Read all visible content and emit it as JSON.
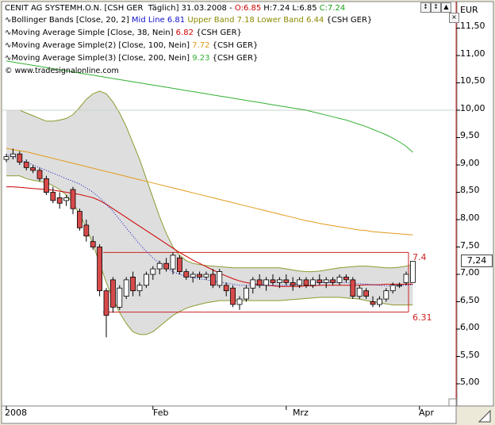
{
  "header": {
    "instrument": "CENIT AG SYSTEMH.O.N. [CSH GER  Täglich] 31.03.2008 - ",
    "open": "O:6.85",
    "high": "H:7.24",
    "low": "L:6.85",
    "close": "C:7.24"
  },
  "indicators": [
    {
      "prefix": "∿Bollinger Bands [Close, 20, 2] ",
      "mid": "Mid Line 6.81",
      "upper": " Upper Band 7.18",
      "lower": " Lower Band 6.44",
      "suffix": " {CSH GER}"
    },
    {
      "prefix": "∿Moving Average Simple [Close, 38, Nein] ",
      "value": "6.82",
      "suffix": " {CSH GER}"
    },
    {
      "prefix": "∿Moving Average Simple(2) [Close, 100, Nein] ",
      "value": "7.72",
      "suffix": " {CSH GER}"
    },
    {
      "prefix": "∿Moving Average Simple(3) [Close, 200, Nein] ",
      "value": "9.23",
      "suffix": " {CSH GER}"
    }
  ],
  "watermark": "© www.tradesignalonline.com",
  "window_buttons": [
    "↕",
    "↕",
    "▲",
    "×"
  ],
  "price_tag": "7,24",
  "colors": {
    "mid": "#1111cc",
    "upper": "#8a8a00",
    "ma38": "#cc0000",
    "ma100": "#e39a1a",
    "ma200": "#33b033",
    "band_fill": "#d8d8d8",
    "band_edge": "#8c9a2e",
    "up_candle": "#ffffff",
    "down_candle": "#d84a4a"
  },
  "chart_data": {
    "type": "candlestick",
    "y_unit": "EUR",
    "ylim": [
      4.5,
      12.0
    ],
    "y_ticks": [
      "11,50",
      "11,00",
      "10,50",
      "10,00",
      "9,50",
      "9,00",
      "8,50",
      "8,00",
      "7,50",
      "7,00",
      "6,50",
      "6,00",
      "5,50",
      "5,00"
    ],
    "y_tick_values": [
      11.5,
      11.0,
      10.5,
      10.0,
      9.5,
      9.0,
      8.5,
      8.0,
      7.5,
      7.0,
      6.5,
      6.0,
      5.5,
      5.0
    ],
    "x_ticks": [
      "2008",
      "Feb",
      "Mrz",
      "Apr"
    ],
    "x_tick_index": [
      0,
      22,
      42,
      62
    ],
    "n_slots": 62,
    "candles": [
      [
        9.1,
        9.2,
        9.05,
        9.15
      ],
      [
        9.15,
        9.3,
        9.1,
        9.2
      ],
      [
        9.2,
        9.25,
        9.0,
        9.05
      ],
      [
        9.05,
        9.1,
        8.9,
        8.95
      ],
      [
        8.95,
        9.0,
        8.85,
        8.9
      ],
      [
        8.9,
        8.95,
        8.7,
        8.75
      ],
      [
        8.75,
        8.8,
        8.45,
        8.5
      ],
      [
        8.5,
        8.6,
        8.3,
        8.35
      ],
      [
        8.4,
        8.5,
        8.2,
        8.3
      ],
      [
        8.35,
        8.45,
        8.25,
        8.4
      ],
      [
        8.55,
        8.6,
        8.1,
        8.2
      ],
      [
        8.15,
        8.2,
        7.8,
        7.85
      ],
      [
        7.9,
        8.0,
        7.6,
        7.7
      ],
      [
        7.6,
        7.7,
        7.45,
        7.5
      ],
      [
        7.5,
        7.55,
        6.6,
        6.7
      ],
      [
        6.7,
        6.75,
        5.85,
        6.25
      ],
      [
        6.9,
        6.95,
        6.3,
        6.4
      ],
      [
        6.4,
        6.8,
        6.35,
        6.75
      ],
      [
        6.6,
        6.95,
        6.55,
        6.9
      ],
      [
        6.95,
        7.05,
        6.6,
        6.7
      ],
      [
        6.7,
        6.85,
        6.6,
        6.8
      ],
      [
        6.8,
        7.05,
        6.75,
        7.0
      ],
      [
        7.0,
        7.15,
        6.9,
        7.1
      ],
      [
        7.1,
        7.25,
        7.0,
        7.2
      ],
      [
        7.2,
        7.3,
        7.05,
        7.1
      ],
      [
        7.1,
        7.4,
        7.0,
        7.35
      ],
      [
        7.3,
        7.35,
        7.0,
        7.05
      ],
      [
        7.05,
        7.1,
        6.9,
        6.95
      ],
      [
        6.95,
        7.05,
        6.85,
        7.0
      ],
      [
        7.0,
        7.05,
        6.9,
        6.95
      ],
      [
        6.95,
        7.05,
        6.9,
        7.0
      ],
      [
        7.0,
        7.1,
        6.75,
        6.8
      ],
      [
        6.8,
        7.1,
        6.75,
        7.05
      ],
      [
        6.8,
        6.85,
        6.6,
        6.7
      ],
      [
        6.75,
        6.8,
        6.4,
        6.45
      ],
      [
        6.45,
        6.6,
        6.35,
        6.55
      ],
      [
        6.55,
        6.8,
        6.5,
        6.75
      ],
      [
        6.75,
        6.95,
        6.65,
        6.9
      ],
      [
        6.9,
        7.0,
        6.75,
        6.8
      ],
      [
        6.8,
        6.95,
        6.7,
        6.9
      ],
      [
        6.9,
        7.0,
        6.8,
        6.85
      ],
      [
        6.85,
        6.95,
        6.75,
        6.9
      ],
      [
        6.9,
        7.0,
        6.8,
        6.85
      ],
      [
        6.85,
        6.95,
        6.7,
        6.8
      ],
      [
        6.8,
        6.95,
        6.75,
        6.9
      ],
      [
        6.9,
        6.95,
        6.75,
        6.8
      ],
      [
        6.8,
        6.95,
        6.75,
        6.9
      ],
      [
        6.9,
        7.0,
        6.8,
        6.85
      ],
      [
        6.85,
        6.95,
        6.75,
        6.9
      ],
      [
        6.9,
        6.95,
        6.8,
        6.85
      ],
      [
        6.85,
        7.0,
        6.8,
        6.95
      ],
      [
        6.95,
        7.0,
        6.85,
        6.9
      ],
      [
        6.9,
        6.95,
        6.55,
        6.6
      ],
      [
        6.6,
        6.8,
        6.55,
        6.75
      ],
      [
        6.7,
        6.75,
        6.55,
        6.6
      ],
      [
        6.5,
        6.6,
        6.4,
        6.45
      ],
      [
        6.45,
        6.6,
        6.4,
        6.55
      ],
      [
        6.55,
        6.75,
        6.5,
        6.7
      ],
      [
        6.7,
        6.85,
        6.65,
        6.8
      ],
      [
        6.8,
        6.85,
        6.75,
        6.8
      ],
      [
        6.85,
        7.05,
        6.8,
        7.0
      ],
      [
        6.85,
        7.24,
        6.85,
        7.24
      ]
    ],
    "ma38": [
      8.6,
      8.6,
      8.59,
      8.58,
      8.57,
      8.56,
      8.55,
      8.54,
      8.52,
      8.5,
      8.48,
      8.46,
      8.43,
      8.4,
      8.35,
      8.28,
      8.2,
      8.12,
      8.04,
      7.96,
      7.88,
      7.8,
      7.72,
      7.64,
      7.56,
      7.48,
      7.4,
      7.33,
      7.26,
      7.2,
      7.14,
      7.08,
      7.02,
      6.97,
      6.92,
      6.88,
      6.85,
      6.83,
      6.81,
      6.8,
      6.79,
      6.78,
      6.78,
      6.78,
      6.78,
      6.79,
      6.79,
      6.8,
      6.8,
      6.8,
      6.8,
      6.8,
      6.8,
      6.8,
      6.81,
      6.81,
      6.81,
      6.82,
      6.82,
      6.82,
      6.82,
      6.82
    ],
    "ma100": [
      9.3,
      9.28,
      9.26,
      9.24,
      9.21,
      9.18,
      9.15,
      9.12,
      9.09,
      9.06,
      9.03,
      9.0,
      8.97,
      8.94,
      8.91,
      8.88,
      8.85,
      8.82,
      8.79,
      8.76,
      8.73,
      8.7,
      8.67,
      8.64,
      8.61,
      8.58,
      8.55,
      8.52,
      8.49,
      8.46,
      8.43,
      8.4,
      8.37,
      8.34,
      8.31,
      8.28,
      8.25,
      8.22,
      8.19,
      8.16,
      8.13,
      8.1,
      8.07,
      8.04,
      8.01,
      7.98,
      7.96,
      7.93,
      7.91,
      7.89,
      7.87,
      7.85,
      7.83,
      7.81,
      7.8,
      7.78,
      7.77,
      7.76,
      7.75,
      7.74,
      7.73,
      7.72
    ],
    "ma200": [
      10.9,
      10.88,
      10.86,
      10.84,
      10.82,
      10.8,
      10.78,
      10.76,
      10.74,
      10.72,
      10.7,
      10.68,
      10.66,
      10.64,
      10.62,
      10.6,
      10.58,
      10.56,
      10.54,
      10.52,
      10.5,
      10.48,
      10.46,
      10.44,
      10.42,
      10.4,
      10.38,
      10.36,
      10.34,
      10.32,
      10.3,
      10.28,
      10.26,
      10.24,
      10.22,
      10.2,
      10.18,
      10.16,
      10.14,
      10.12,
      10.1,
      10.08,
      10.06,
      10.04,
      10.02,
      10.0,
      9.97,
      9.94,
      9.91,
      9.88,
      9.85,
      9.82,
      9.78,
      9.74,
      9.7,
      9.65,
      9.6,
      9.55,
      9.49,
      9.42,
      9.34,
      9.23
    ],
    "bb_mid": [
      9.2,
      9.15,
      9.1,
      9.05,
      9.0,
      8.95,
      8.9,
      8.85,
      8.8,
      8.75,
      8.7,
      8.65,
      8.58,
      8.5,
      8.4,
      8.28,
      8.15,
      8.0,
      7.85,
      7.7,
      7.55,
      7.42,
      7.3,
      7.2,
      7.12,
      7.05,
      7.0,
      6.97,
      6.94,
      6.92,
      6.9,
      6.88,
      6.86,
      6.84,
      6.82,
      6.8,
      6.8,
      6.8,
      6.8,
      6.8,
      6.8,
      6.8,
      6.8,
      6.81,
      6.82,
      6.83,
      6.84,
      6.85,
      6.85,
      6.85,
      6.85,
      6.85,
      6.84,
      6.83,
      6.82,
      6.81,
      6.8,
      6.79,
      6.79,
      6.8,
      6.8,
      6.81
    ],
    "bb_upper": [
      10.0,
      10.0,
      10.0,
      9.95,
      9.9,
      9.85,
      9.8,
      9.8,
      9.82,
      9.85,
      9.92,
      10.05,
      10.2,
      10.3,
      10.35,
      10.3,
      10.15,
      9.95,
      9.7,
      9.4,
      9.1,
      8.75,
      8.4,
      8.05,
      7.75,
      7.5,
      7.35,
      7.25,
      7.2,
      7.18,
      7.16,
      7.15,
      7.14,
      7.13,
      7.12,
      7.12,
      7.12,
      7.12,
      7.12,
      7.12,
      7.12,
      7.12,
      7.1,
      7.08,
      7.06,
      7.05,
      7.05,
      7.06,
      7.08,
      7.1,
      7.12,
      7.13,
      7.14,
      7.15,
      7.15,
      7.14,
      7.13,
      7.12,
      7.12,
      7.13,
      7.15,
      7.18
    ],
    "bb_lower": [
      8.8,
      8.8,
      8.8,
      8.75,
      8.72,
      8.7,
      8.68,
      8.62,
      8.55,
      8.45,
      8.3,
      8.1,
      7.85,
      7.55,
      7.2,
      6.85,
      6.55,
      6.3,
      6.1,
      5.95,
      5.9,
      5.9,
      5.95,
      6.05,
      6.15,
      6.25,
      6.32,
      6.38,
      6.42,
      6.45,
      6.48,
      6.5,
      6.52,
      6.52,
      6.52,
      6.52,
      6.52,
      6.52,
      6.52,
      6.52,
      6.52,
      6.52,
      6.53,
      6.54,
      6.55,
      6.56,
      6.57,
      6.58,
      6.58,
      6.58,
      6.58,
      6.57,
      6.56,
      6.55,
      6.52,
      6.5,
      6.48,
      6.46,
      6.44,
      6.44,
      6.44,
      6.44
    ],
    "hlines": [
      {
        "value": 7.4,
        "label": "7.4"
      },
      {
        "value": 6.31,
        "label": "6.31"
      }
    ],
    "grid_line": 10.0
  }
}
